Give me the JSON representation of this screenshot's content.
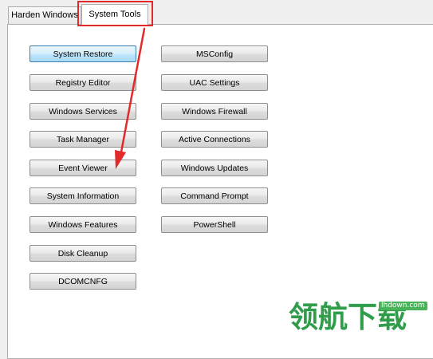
{
  "tabs": [
    {
      "label": "Harden Windows",
      "selected": false
    },
    {
      "label": "System Tools",
      "selected": true
    }
  ],
  "buttons_left": [
    "System Restore",
    "Registry Editor",
    "Windows Services",
    "Task Manager",
    "Event Viewer",
    "System Information",
    "Windows Features",
    "Disk Cleanup",
    "DCOMCNFG"
  ],
  "buttons_right": [
    "MSConfig",
    "UAC Settings",
    "Windows Firewall",
    "Active Connections",
    "Windows Updates",
    "Command Prompt",
    "PowerShell"
  ],
  "annotation": {
    "color": "#e32a2a"
  },
  "watermark": {
    "text": "领航下载",
    "url": "lhdown.com",
    "color": "#2f9d4a"
  }
}
